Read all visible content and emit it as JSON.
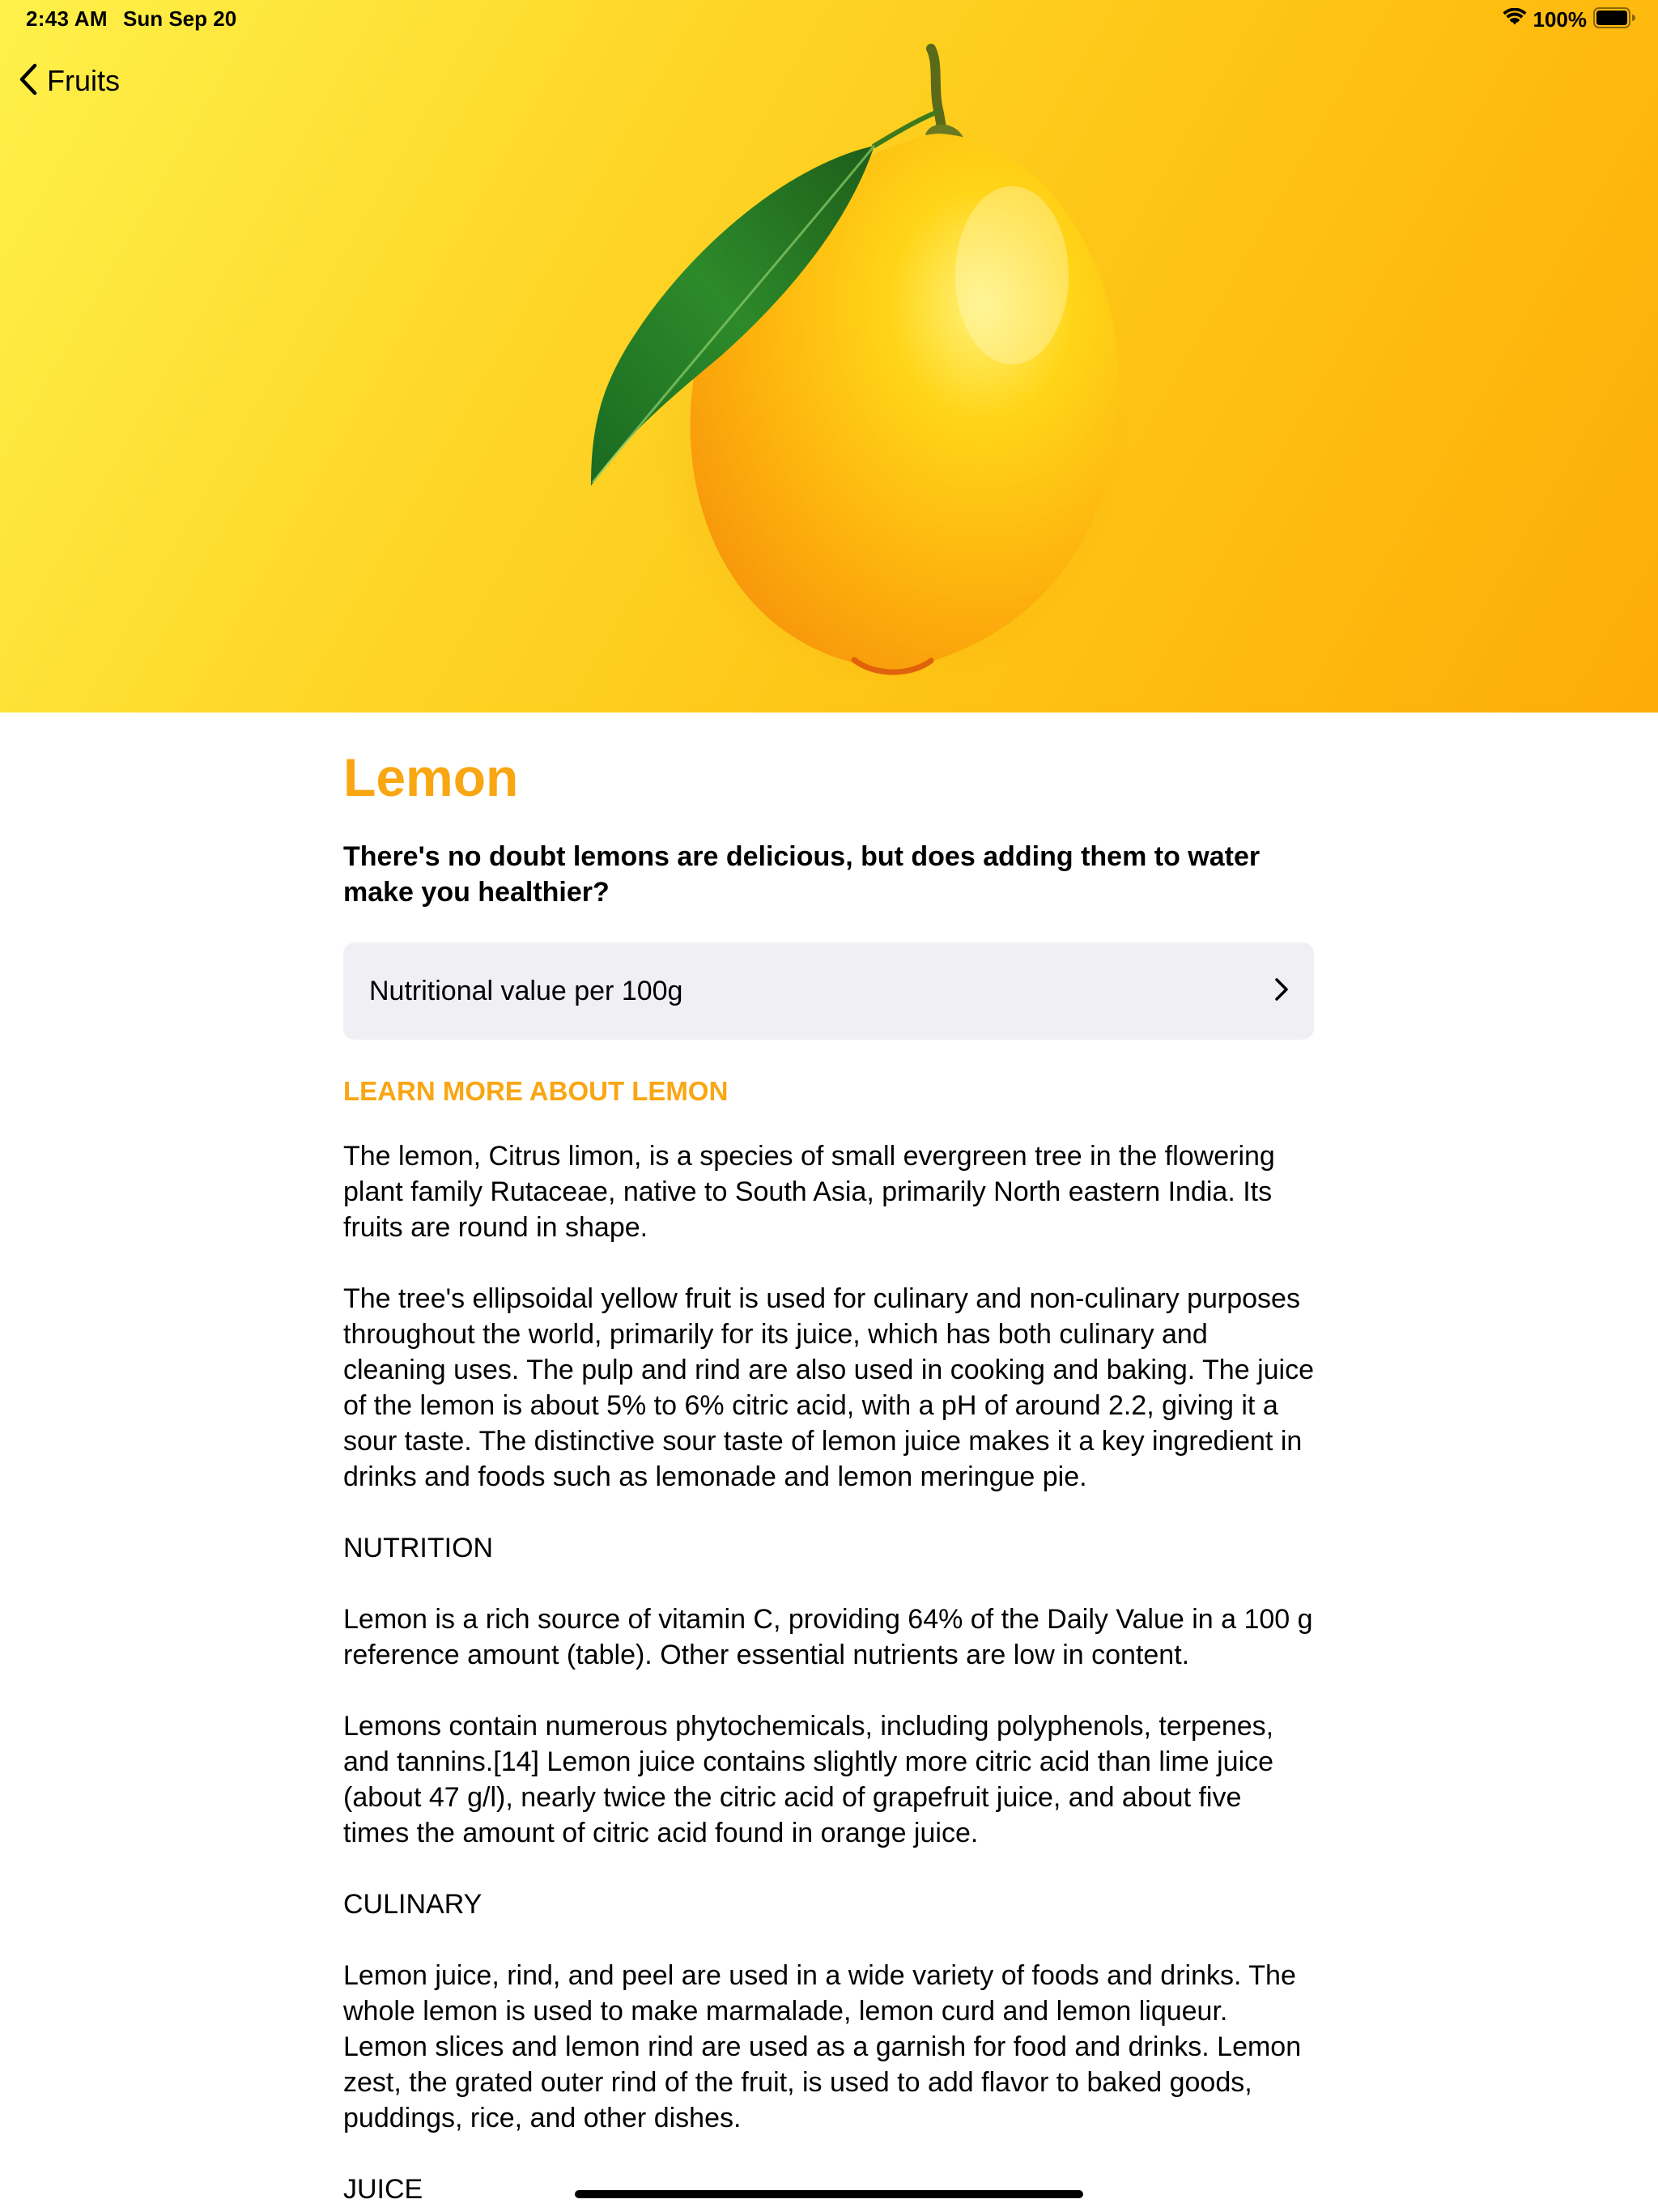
{
  "status_bar": {
    "time": "2:43 AM",
    "date": "Sun Sep 20",
    "battery": "100%",
    "wifi_icon": "wifi-icon",
    "battery_icon": "battery-icon"
  },
  "nav": {
    "back_label": "Fruits",
    "back_icon": "chevron-left-icon"
  },
  "colors": {
    "accent": "#f9a613",
    "hero_start": "#fef14a",
    "hero_end": "#fdac08",
    "row_background": "#efeff4"
  },
  "article": {
    "title": "Lemon",
    "subtitle": "There's no doubt lemons are delicious, but does adding them to water make you healthier?",
    "nutrition_row_label": "Nutritional value per 100g",
    "nutrition_row_icon": "chevron-right-icon",
    "learn_more_heading": "LEARN MORE ABOUT LEMON",
    "paragraphs": [
      "The lemon, Citrus limon, is a species of small evergreen tree in the flowering plant family Rutaceae, native to South Asia, primarily North eastern India. Its fruits are round in shape.",
      "The tree's ellipsoidal yellow fruit is used for culinary and non-culinary purposes throughout the world, primarily for its juice, which has both culinary and cleaning uses. The pulp and rind are also used in cooking and baking. The juice of the lemon is about 5% to 6% citric acid, with a pH of around 2.2, giving it a sour taste. The distinctive sour taste of lemon juice makes it a key ingredient in drinks and foods such as lemonade and lemon meringue pie.",
      "NUTRITION",
      "Lemon is a rich source of vitamin C, providing 64% of the Daily Value in a 100 g reference amount (table). Other essential nutrients are low in content.",
      "Lemons contain numerous phytochemicals, including polyphenols, terpenes, and tannins.[14] Lemon juice contains slightly more citric acid than lime juice (about 47 g/l), nearly twice the citric acid of grapefruit juice, and about five times the amount of citric acid found in orange juice.",
      "CULINARY",
      "Lemon juice, rind, and peel are used in a wide variety of foods and drinks. The whole lemon is used to make marmalade, lemon curd and lemon liqueur. Lemon slices and lemon rind are used as a garnish for food and drinks. Lemon zest, the grated outer rind of the fruit, is used to add flavor to baked goods, puddings, rice, and other dishes.",
      "JUICE"
    ]
  }
}
